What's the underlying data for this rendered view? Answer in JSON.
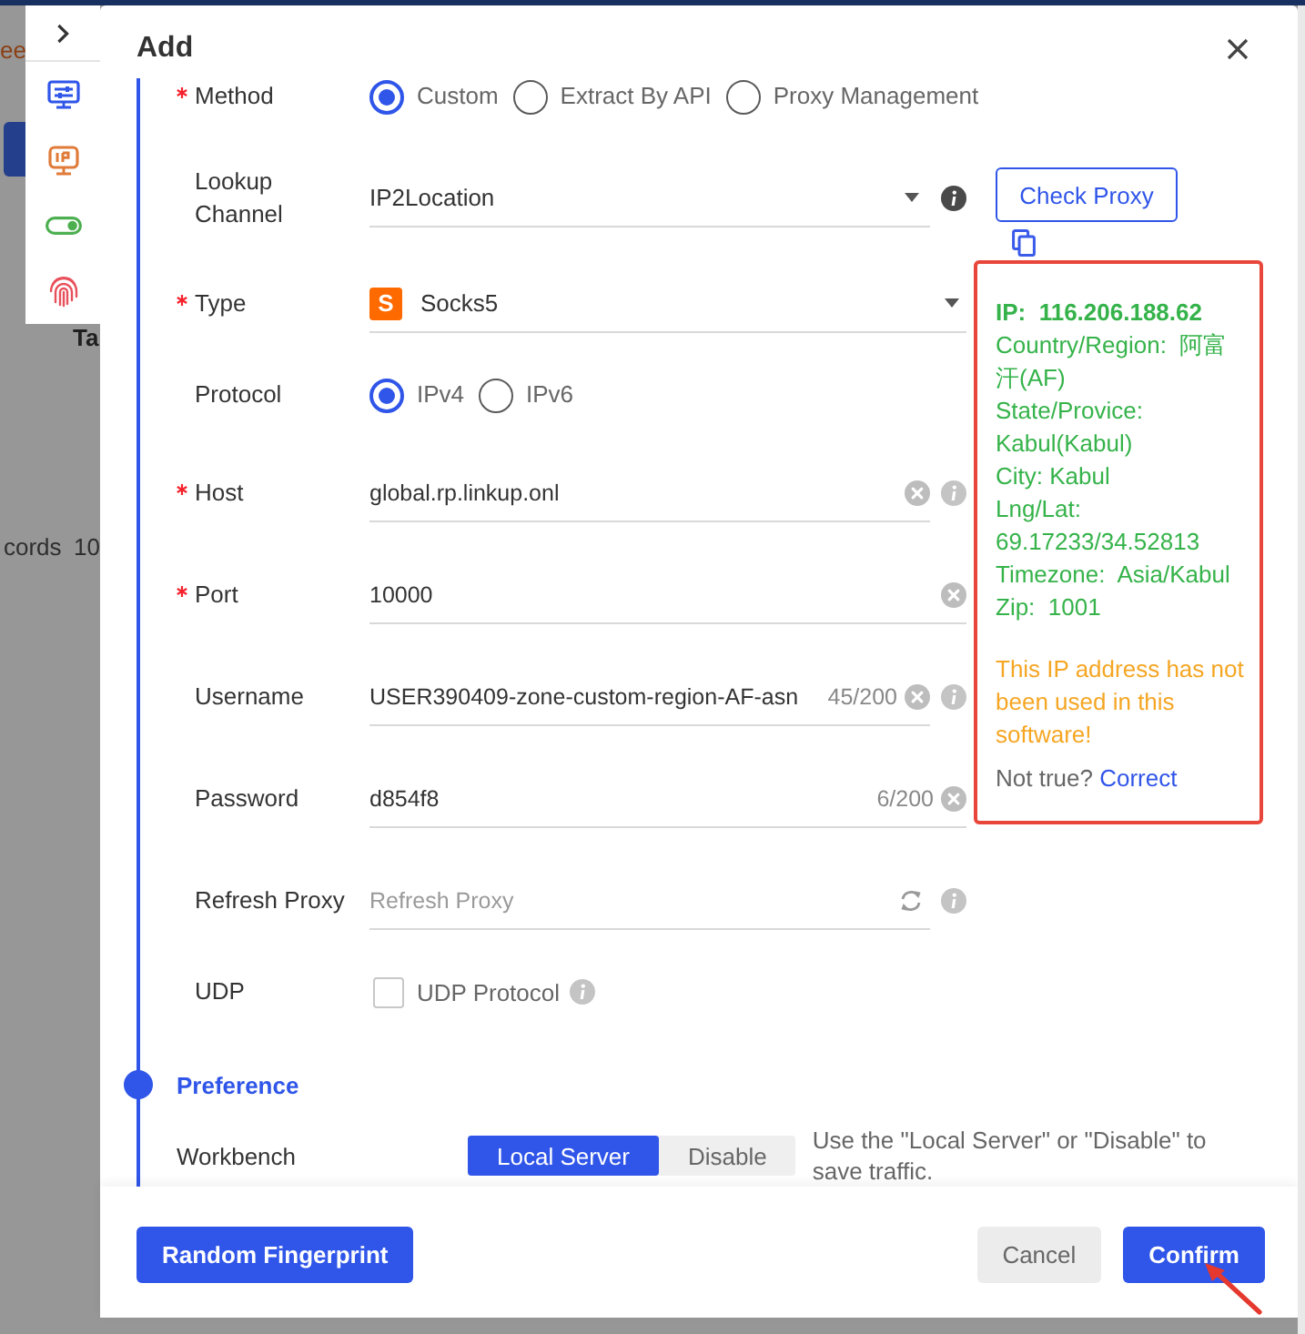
{
  "background": {
    "fragments": [
      "ee",
      "Ta",
      "cords",
      "10"
    ]
  },
  "dialog": {
    "title": "Add"
  },
  "form": {
    "rows": [
      {
        "kind": "radio",
        "label": "Method",
        "required": true,
        "options": [
          {
            "label": "Custom",
            "selected": true
          },
          {
            "label": "Extract By API",
            "selected": false
          },
          {
            "label": "Proxy Management",
            "selected": false
          }
        ]
      },
      {
        "kind": "select",
        "label": "Lookup Channel",
        "required": false,
        "value": "IP2Location",
        "info": true
      },
      {
        "kind": "select",
        "label": "Type",
        "required": true,
        "badge": "S",
        "value": "Socks5",
        "info": false
      },
      {
        "kind": "radio",
        "label": "Protocol",
        "required": false,
        "options": [
          {
            "label": "IPv4",
            "selected": true
          },
          {
            "label": "IPv6",
            "selected": false
          }
        ]
      },
      {
        "kind": "input",
        "label": "Host",
        "required": true,
        "value": "global.rp.linkup.onl",
        "clearable": true,
        "info": true
      },
      {
        "kind": "input",
        "label": "Port",
        "required": true,
        "value": "10000",
        "clearable": true,
        "info": false
      },
      {
        "kind": "input",
        "label": "Username",
        "required": false,
        "value": "USER390409-zone-custom-region-AF-asn",
        "counter": "45/200",
        "clearable": true,
        "info": true
      },
      {
        "kind": "input",
        "label": "Password",
        "required": false,
        "value": "d854f8",
        "counter": "6/200",
        "clearable": true,
        "info": false
      },
      {
        "kind": "input",
        "label": "Refresh Proxy",
        "required": false,
        "placeholder": "Refresh Proxy",
        "refresh": true,
        "info": true
      },
      {
        "kind": "checkbox",
        "label": "UDP",
        "required": false,
        "option": "UDP Protocol",
        "checked": false,
        "info": true
      }
    ]
  },
  "check_proxy": {
    "button": "Check Proxy",
    "result": {
      "details": [
        {
          "kind": "heading",
          "text": "IP:  116.206.188.62"
        },
        {
          "kind": "detail",
          "text": "Country/Region:  阿富汗(AF)"
        },
        {
          "kind": "detail",
          "text": "State/Provice: Kabul(Kabul)"
        },
        {
          "kind": "detail",
          "text": "City: Kabul"
        },
        {
          "kind": "detail",
          "text": "Lng/Lat:  69.17233/34.52813"
        },
        {
          "kind": "detail",
          "text": "Timezone:  Asia/Kabul"
        },
        {
          "kind": "detail",
          "text": "Zip:  1001"
        }
      ],
      "warning": "This IP address has not been used in this software!",
      "note": "Not true?",
      "link": "Correct"
    }
  },
  "preference": {
    "title": "Preference",
    "rows": [
      {
        "label": "Workbench",
        "options": [
          {
            "label": "Local Server",
            "selected": true
          },
          {
            "label": "Disable",
            "selected": false
          }
        ],
        "hint": "Use the \"Local Server\" or \"Disable\" to save traffic."
      }
    ]
  },
  "footer": {
    "buttons": [
      {
        "label": "Random Fingerprint",
        "kind": "primary"
      },
      {
        "label": "Cancel",
        "kind": "secondary"
      },
      {
        "label": "Confirm",
        "kind": "primary"
      }
    ]
  }
}
